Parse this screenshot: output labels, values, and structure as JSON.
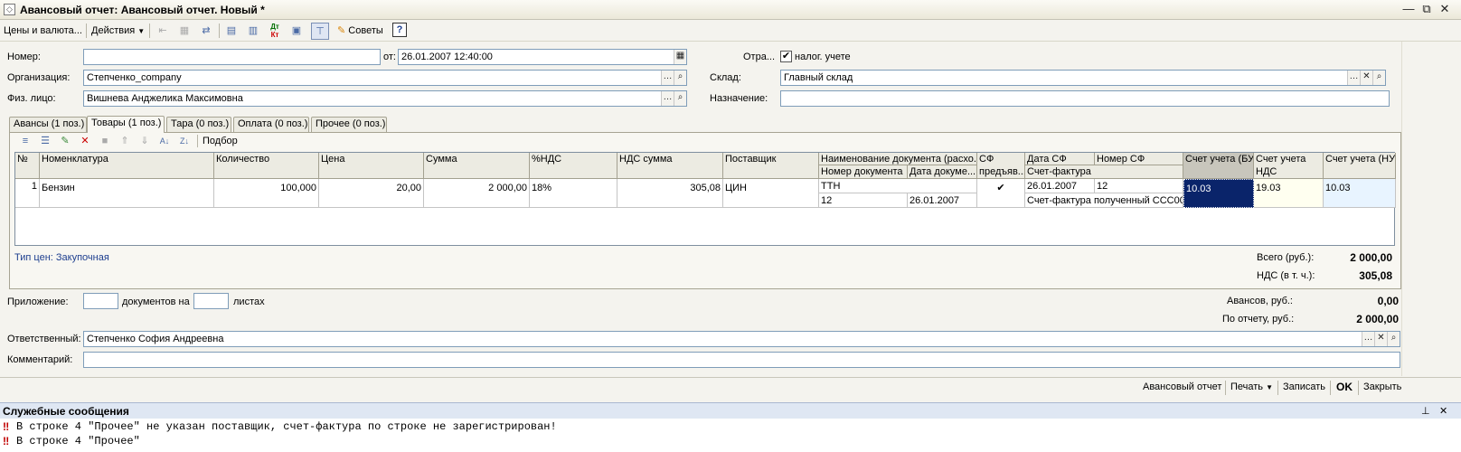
{
  "window": {
    "title": "Авансовый отчет: Авансовый отчет. Новый *",
    "icon_glyph": "◇",
    "minimize": "—",
    "restore": "⧉",
    "close": "✕"
  },
  "toolbar": {
    "prices_label": "Цены и валюта...",
    "actions_label": "Действия",
    "tips_label": "Советы",
    "help_label": "?",
    "dtkt_top": "Дт",
    "dtkt_bottom": "Кт"
  },
  "header": {
    "number_label": "Номер:",
    "number_value": "",
    "date_label": "от:",
    "date_value": "26.01.2007 12:40:00",
    "reflect_label": "Отра...",
    "tax_checkbox_label": "налог. учете",
    "tax_checked": "✔",
    "org_label": "Организация:",
    "org_value": "Степченко_company",
    "warehouse_label": "Склад:",
    "warehouse_value": "Главный склад",
    "person_label": "Физ. лицо:",
    "person_value": "Вишнева Анджелика Максимовна",
    "purpose_label": "Назначение:",
    "purpose_value": ""
  },
  "tabs": [
    {
      "label": "Авансы (1 поз.)"
    },
    {
      "label": "Товары (1 поз.)"
    },
    {
      "label": "Тара (0 поз.)"
    },
    {
      "label": "Оплата (0 поз.)"
    },
    {
      "label": "Прочее (0 поз.)"
    }
  ],
  "grid_toolbar": {
    "select_label": "Подбор"
  },
  "table": {
    "headers": {
      "n": "№",
      "nomenclature": "Номенклатура",
      "quantity": "Количество",
      "price": "Цена",
      "sum": "Сумма",
      "vat_rate": "%НДС",
      "vat_sum": "НДС сумма",
      "supplier": "Поставщик",
      "doc_name": "Наименование документа (расхо...",
      "doc_number": "Номер документа",
      "doc_date": "Дата докуме...",
      "sf_top": "СФ",
      "sf_bottom": "предъяв...",
      "sf_date": "Дата СФ",
      "sf_number": "Номер СФ",
      "sf_invoice": "Счет-фактура",
      "account_bu": "Счет учета (БУ)",
      "account_vat_1": "Счет учета",
      "account_vat_2": "НДС",
      "account_nu": "Счет учета (НУ)"
    },
    "row": {
      "n": "1",
      "nomenclature": "Бензин",
      "quantity": "100,000",
      "price": "20,00",
      "sum": "2 000,00",
      "vat_rate": "18%",
      "vat_sum": "305,08",
      "supplier": "ЦИН",
      "doc_name": "ТТН",
      "doc_number": "12",
      "doc_date": "26.01.2007",
      "sf_presented": "✔",
      "sf_date": "26.01.2007",
      "sf_number": "12",
      "sf_invoice": "Счет-фактура полученный ССС00...",
      "account_bu": "10.03",
      "account_vat": "19.03",
      "account_nu": "10.03"
    }
  },
  "price_type": "Тип цен: Закупочная",
  "totals": {
    "total_label": "Всего (руб.):",
    "total_value": "2 000,00",
    "vat_label": "НДС (в т. ч.):",
    "vat_value": "305,08"
  },
  "attachment": {
    "label": "Приложение:",
    "docs_value": "",
    "docs_on_label": "документов на",
    "sheets_value": "",
    "sheets_label": "листах"
  },
  "summary": {
    "advances_label": "Авансов, руб.:",
    "advances_value": "0,00",
    "report_label": "По отчету, руб.:",
    "report_value": "2 000,00"
  },
  "responsible": {
    "label": "Ответственный:",
    "value": "Степченко София Андреевна"
  },
  "comment": {
    "label": "Комментарий:",
    "value": ""
  },
  "bottom_buttons": {
    "advance_report": "Авансовый отчет",
    "print": "Печать",
    "save": "Записать",
    "ok": "OK",
    "close": "Закрыть"
  },
  "messages": {
    "title": "Служебные сообщения",
    "pin": "⊥",
    "close": "✕",
    "marker": "‼",
    "line1": "В строке 4 \"Прочее\" не указан поставщик,  счет-фактура по строке не зарегистрирован!",
    "line2": "В строке 4 \"Прочее\""
  },
  "colors": {
    "selected_cell": "#0a246a",
    "vat_account_bg": "#fffff0",
    "nu_account_bg": "#e8f4ff",
    "link_blue": "#1e3f8f",
    "error_red": "#c00000"
  }
}
